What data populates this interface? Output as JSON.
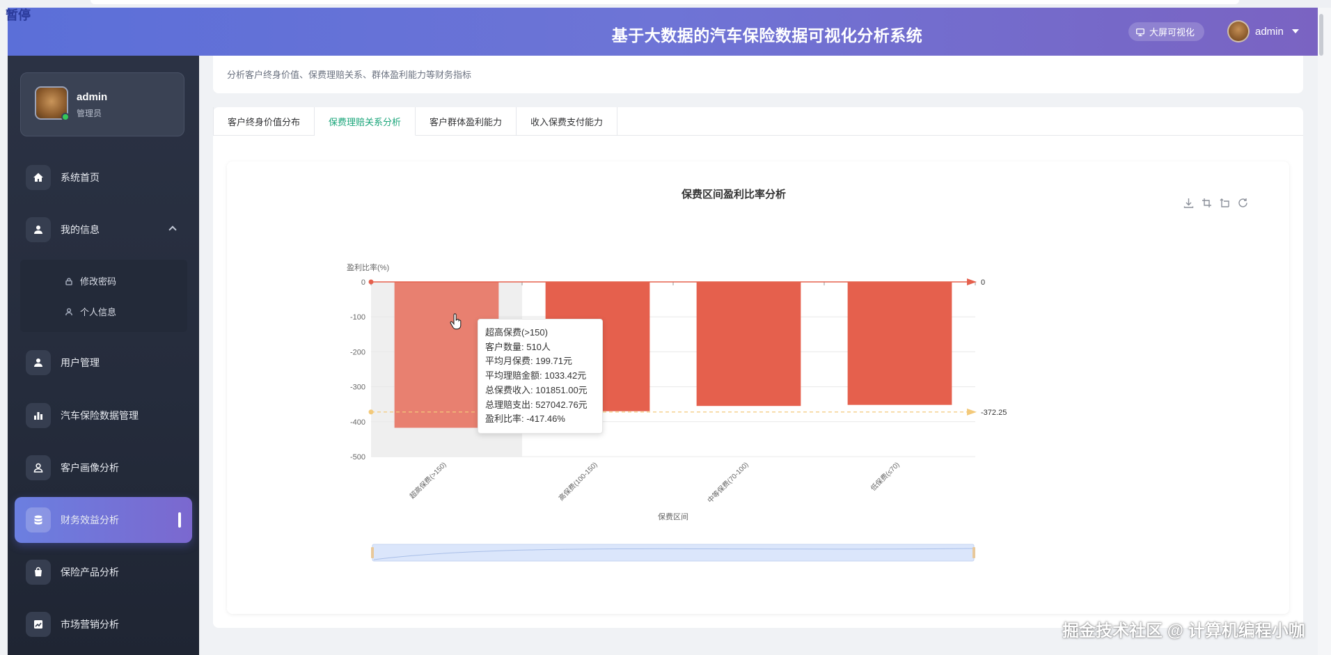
{
  "corner_tag": "暂停",
  "header": {
    "title": "基于大数据的汽车保险数据可视化分析系统",
    "bigscreen_label": "大屏可视化",
    "username": "admin"
  },
  "sidebar": {
    "profile": {
      "name": "admin",
      "role": "管理员"
    },
    "items": [
      {
        "label": "系统首页",
        "icon": "home-icon"
      },
      {
        "label": "我的信息",
        "icon": "user-icon"
      },
      {
        "label": "用户管理",
        "icon": "user-icon"
      },
      {
        "label": "汽车保险数据管理",
        "icon": "bar-chart-icon"
      },
      {
        "label": "客户画像分析",
        "icon": "user-outline-icon"
      },
      {
        "label": "财务效益分析",
        "icon": "database-icon",
        "active": true
      },
      {
        "label": "保险产品分析",
        "icon": "shopping-bag-icon"
      },
      {
        "label": "市场营销分析",
        "icon": "line-chart-icon"
      }
    ],
    "submenu": [
      {
        "label": "修改密码",
        "icon": "lock-icon"
      },
      {
        "label": "个人信息",
        "icon": "person-icon"
      }
    ]
  },
  "page": {
    "description": "分析客户终身价值、保费理赔关系、群体盈利能力等财务指标",
    "tabs": [
      {
        "label": "客户终身价值分布"
      },
      {
        "label": "保费理赔关系分析",
        "active": true
      },
      {
        "label": "客户群体盈利能力"
      },
      {
        "label": "收入保费支付能力"
      }
    ]
  },
  "chart_data": {
    "type": "bar",
    "title": "保费区间盈利比率分析",
    "xlabel": "保费区间",
    "ylabel": "盈利比率(%)",
    "categories": [
      "超高保费(>150)",
      "高保费(100-150)",
      "中等保费(70-100)",
      "低保费(≤70)"
    ],
    "values": [
      -417.46,
      -370,
      -355,
      -352
    ],
    "ylim": [
      -500,
      0
    ],
    "yticks": [
      "0",
      "-100",
      "-200",
      "-300",
      "-400",
      "-500"
    ],
    "markline_max": {
      "value": 0,
      "label": "0"
    },
    "markline_avg": {
      "value": -372.25,
      "label": "-372.25"
    },
    "bar_color": "#e5604d",
    "highlight_color": "#e88070",
    "highlight_index": 0,
    "grid": true,
    "legend": "none"
  },
  "tooltip": {
    "lines": [
      "超高保费(>150)",
      "客户数量: 510人",
      "平均月保费: 199.71元",
      "平均理赔金额: 1033.42元",
      "总保费收入: 101851.00元",
      "总理赔支出: 527042.76元",
      "盈利比率: -417.46%"
    ]
  },
  "watermark": "掘金技术社区 @ 计算机编程小咖"
}
